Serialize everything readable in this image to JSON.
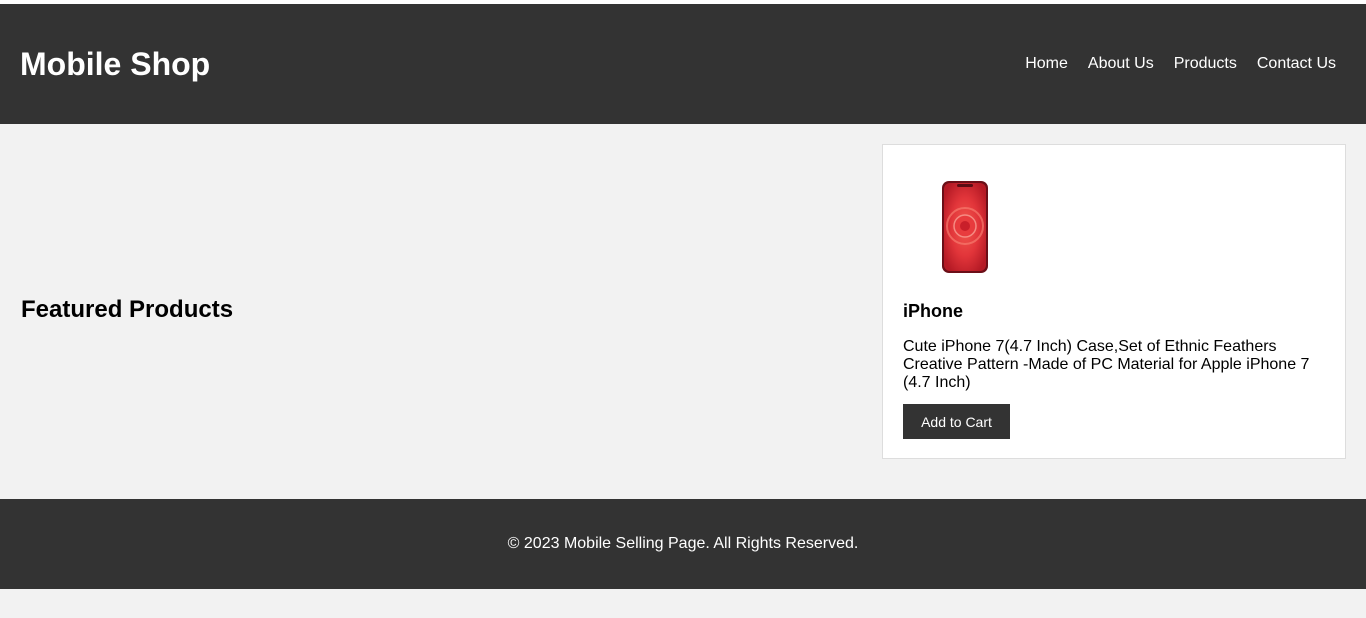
{
  "header": {
    "logo": "Mobile Shop",
    "nav": [
      "Home",
      "About Us",
      "Products",
      "Contact Us"
    ]
  },
  "main": {
    "section_title": "Featured Products",
    "product": {
      "icon": "phone-image",
      "title": "iPhone",
      "description": "Cute iPhone 7(4.7 Inch) Case,Set of Ethnic Feathers Creative Pattern -Made of PC Material for Apple iPhone 7 (4.7 Inch)",
      "button_label": "Add to Cart"
    }
  },
  "footer": {
    "text": "© 2023 Mobile Selling Page. All Rights Reserved."
  },
  "colors": {
    "header_bg": "#333333",
    "page_bg": "#f2f2f2",
    "phone_red": "#d9262c"
  }
}
